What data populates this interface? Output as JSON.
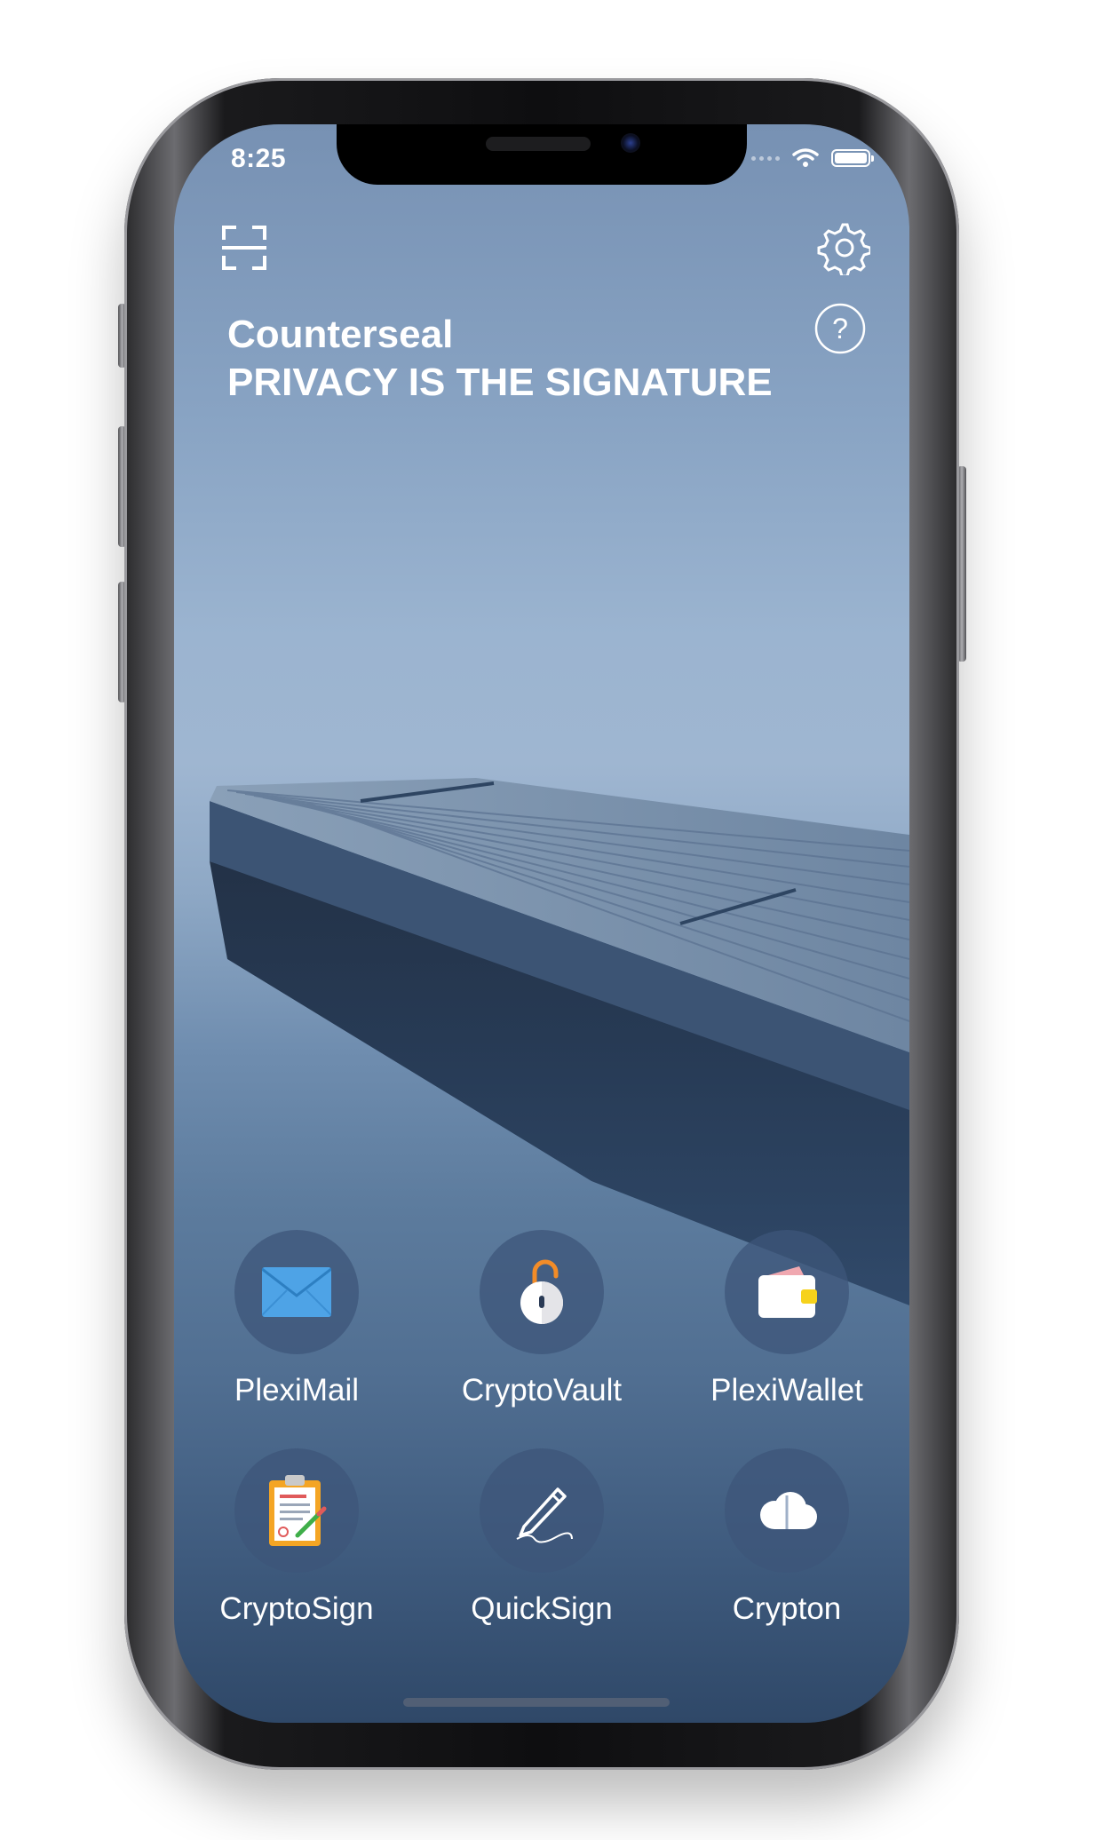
{
  "status_bar": {
    "time": "8:25"
  },
  "header": {
    "app_name": "Counterseal",
    "tagline": "PRIVACY IS THE SIGNATURE"
  },
  "toolbar": {
    "scan_icon": "scan-icon",
    "settings_icon": "gear-icon",
    "help_icon": "help-icon"
  },
  "apps": [
    {
      "label": "PlexiMail",
      "icon": "mail-icon"
    },
    {
      "label": "CryptoVault",
      "icon": "lock-icon"
    },
    {
      "label": "PlexiWallet",
      "icon": "wallet-icon"
    },
    {
      "label": "CryptoSign",
      "icon": "clipboard-sign-icon"
    },
    {
      "label": "QuickSign",
      "icon": "pen-icon"
    },
    {
      "label": "Crypton",
      "icon": "cloud-icon"
    }
  ],
  "colors": {
    "accent_blue": "#4ea3e6",
    "lock_orange": "#f28c28",
    "wallet_yellow": "#f6d21c",
    "clipboard_orange": "#f4a524"
  }
}
